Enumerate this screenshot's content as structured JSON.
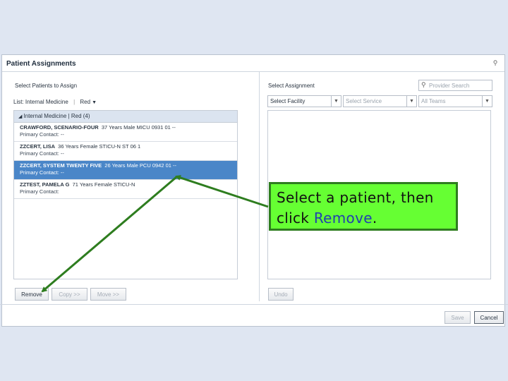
{
  "dialog": {
    "title": "Patient Assignments",
    "pin_icon": "pin-icon"
  },
  "left": {
    "section_label": "Select Patients to Assign",
    "list_prefix": "List:",
    "list_name": "Internal Medicine",
    "list_separator": "|",
    "list_filter": "Red",
    "group_header": "Internal Medicine | Red (4)",
    "patients": [
      {
        "name": "CRAWFORD, SCENARIO-FOUR",
        "details": "37 Years   Male   MICU 0931 01   --",
        "contact": "Primary Contact: --",
        "selected": false
      },
      {
        "name": "ZZCERT, LISA",
        "details": "36 Years   Female   STICU-N ST 06 1",
        "contact": "Primary Contact: --",
        "selected": false
      },
      {
        "name": "ZZCERT, SYSTEM TWENTY FIVE",
        "details": "26 Years   Male   PCU 0942 01   --",
        "contact": "Primary Contact: --",
        "selected": true
      },
      {
        "name": "ZZTEST, PAMELA G",
        "details": "71 Years   Female   STICU-N",
        "contact": "Primary Contact:",
        "selected": false
      }
    ],
    "buttons": {
      "remove": "Remove",
      "copy": "Copy >>",
      "move": "Move >>"
    }
  },
  "right": {
    "section_label": "Select Assignment",
    "search": {
      "placeholder": "Provider Search",
      "value": ""
    },
    "selects": {
      "facility": "Select Facility",
      "service": "Select Service",
      "teams": "All Teams"
    },
    "undo": "Undo"
  },
  "footer": {
    "save": "Save",
    "cancel": "Cancel"
  },
  "callout": {
    "line1": "Select a patient, then",
    "line2_prefix": "click ",
    "line2_keyword": "Remove",
    "line2_suffix": "."
  },
  "colors": {
    "selected_row": "#4a86c8",
    "callout_fill": "#66ff33",
    "callout_border": "#2e7d1f",
    "keyword": "#2040b0"
  }
}
